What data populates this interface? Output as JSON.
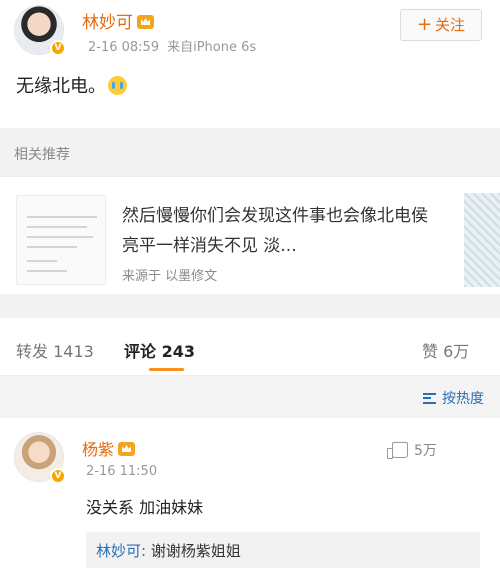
{
  "post": {
    "author": "林妙可",
    "date": "2-16 08:59",
    "source": "来自iPhone 6s",
    "text": "无缘北电。",
    "follow_label": "关注",
    "emoji": "crying-emoji"
  },
  "recommend": {
    "section_title": "相关推荐",
    "title": "然后慢慢你们会发现这件事也会像北电侯亮平一样消失不见 淡...",
    "source": "来源于 以墨修文"
  },
  "tabs": [
    {
      "label": "转发 1413"
    },
    {
      "label": "评论 243"
    },
    {
      "label": "赞 6万"
    }
  ],
  "sort": {
    "label": "按热度"
  },
  "comment": {
    "author": "杨紫",
    "time": "2-16 11:50",
    "likes": "5万",
    "text": "没关系 加油妹妹",
    "reply_author": "林妙可:",
    "reply_text": "谢谢杨紫姐姐"
  },
  "colors": {
    "name_orange": "#e86b0e",
    "link_blue": "#2a6fb6",
    "tab_underline": "#f88f1d",
    "verified_badge": "#f7a600"
  }
}
